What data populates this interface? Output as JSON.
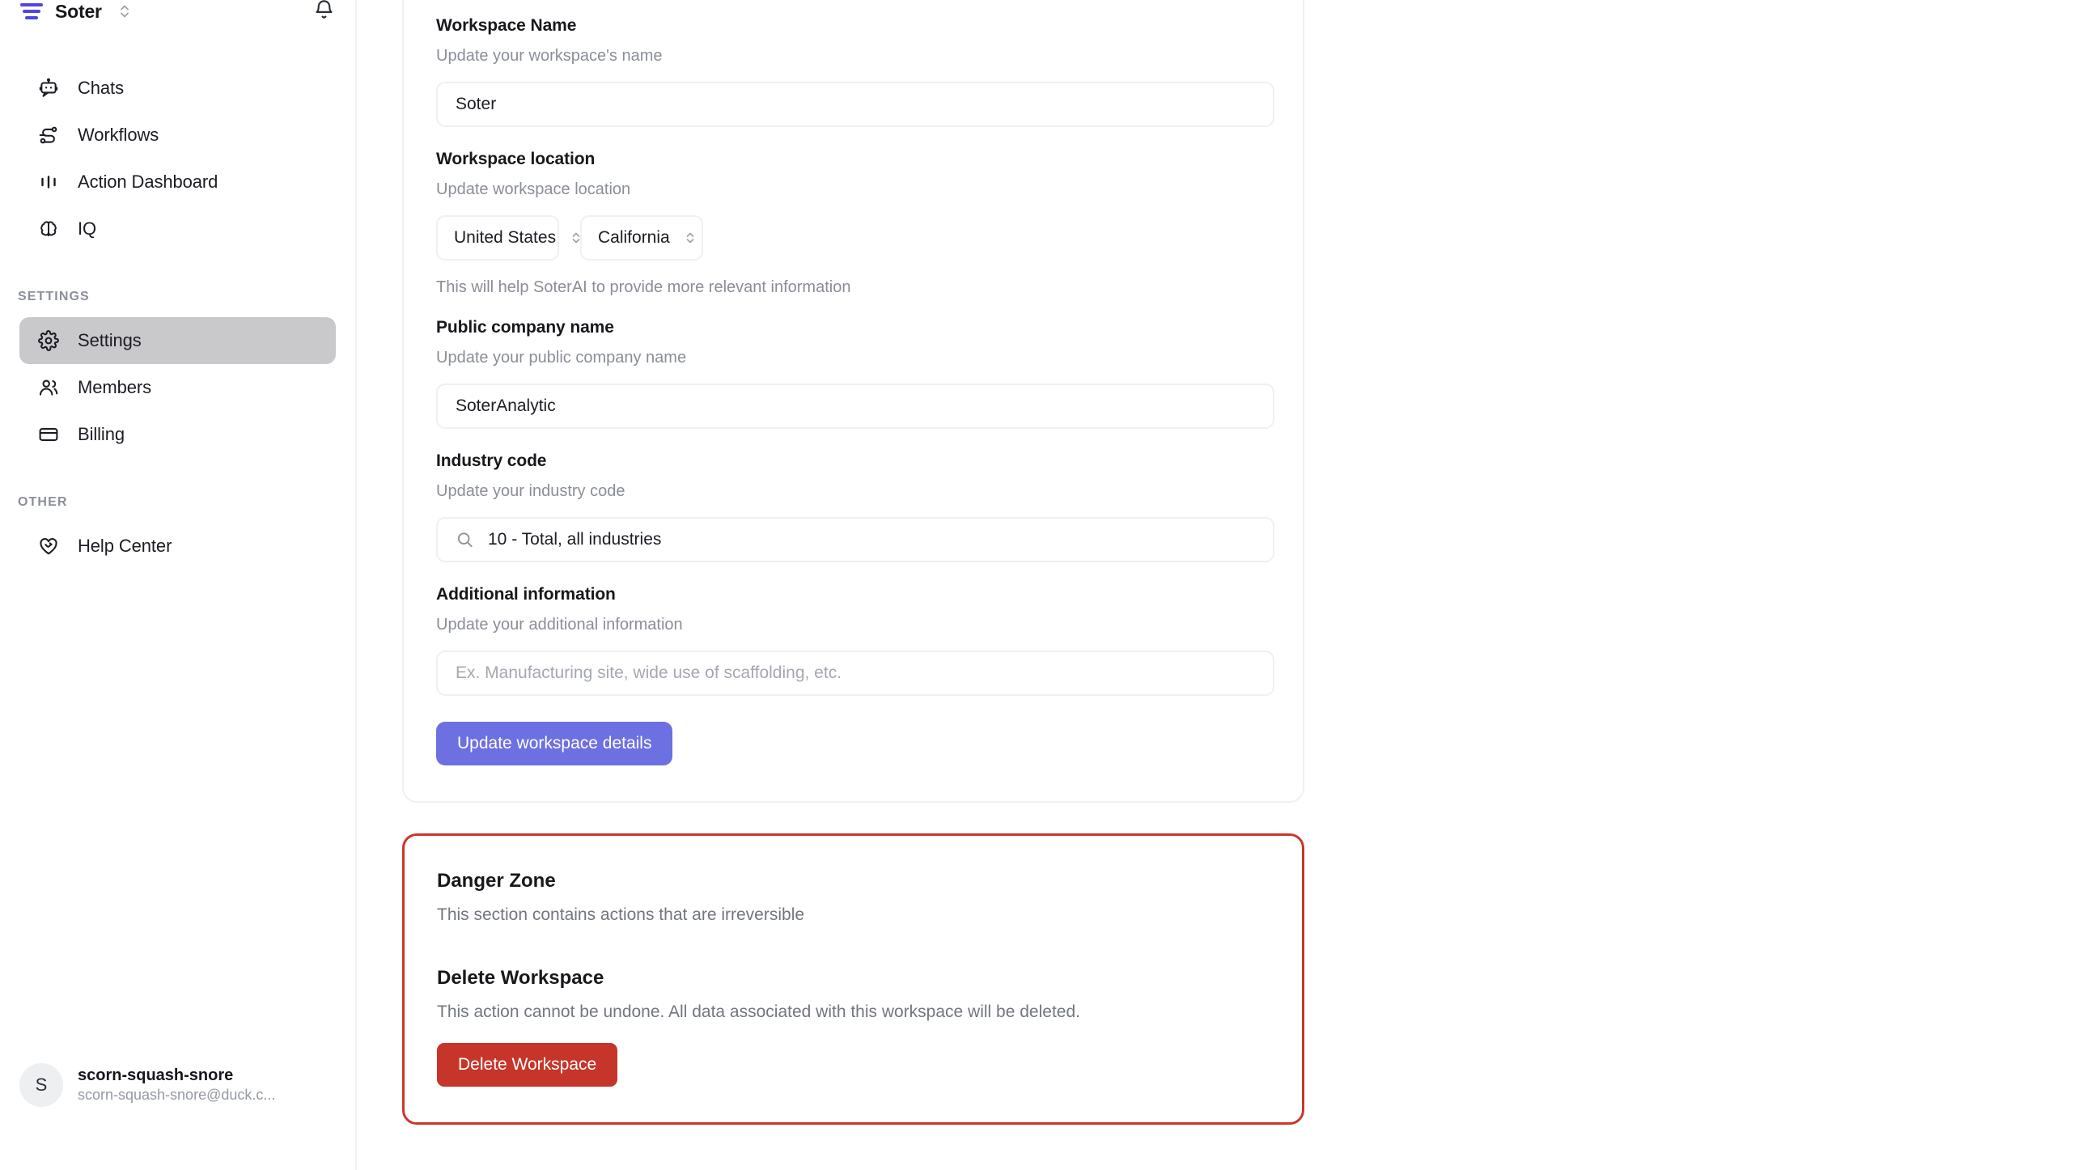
{
  "sidebar": {
    "brand": {
      "name": "Soter",
      "logo_icon": "soter-bars-logo",
      "switcher_icon": "chevron-updown-icon",
      "logo_color": "#4f46e5"
    },
    "notifications_icon": "bell-icon",
    "nav": [
      {
        "label": "Chats",
        "icon": "bot-chat-icon",
        "active": false
      },
      {
        "label": "Workflows",
        "icon": "workflow-nodes-icon",
        "active": false
      },
      {
        "label": "Action Dashboard",
        "icon": "bar-chart-icon",
        "active": false
      },
      {
        "label": "IQ",
        "icon": "brain-icon",
        "active": false
      }
    ],
    "sections": [
      {
        "title": "SETTINGS",
        "items": [
          {
            "label": "Settings",
            "icon": "gear-icon",
            "active": true
          },
          {
            "label": "Members",
            "icon": "users-icon",
            "active": false
          },
          {
            "label": "Billing",
            "icon": "credit-card-icon",
            "active": false
          }
        ]
      },
      {
        "title": "OTHER",
        "items": [
          {
            "label": "Help Center",
            "icon": "heart-handshake-icon",
            "active": false
          }
        ]
      }
    ],
    "profile": {
      "initial": "S",
      "name": "scorn-squash-snore",
      "email": "scorn-squash-snore@duck.c..."
    }
  },
  "workspace_form": {
    "workspace_name": {
      "label": "Workspace Name",
      "description": "Update your workspace's name",
      "value": "Soter",
      "placeholder": ""
    },
    "workspace_location": {
      "label": "Workspace location",
      "description": "Update workspace location",
      "country_value": "United States",
      "state_value": "California",
      "hint": "This will help SoterAI to provide more relevant information"
    },
    "public_company_name": {
      "label": "Public company name",
      "description": "Update your public company name",
      "value": "SoterAnalytic",
      "placeholder": ""
    },
    "industry_code": {
      "label": "Industry code",
      "description": "Update your industry code",
      "value": "10 - Total, all industries",
      "placeholder": "",
      "icon": "search-icon"
    },
    "additional_information": {
      "label": "Additional information",
      "description": "Update your additional information",
      "value": "",
      "placeholder": "Ex. Manufacturing site, wide use of scaffolding, etc."
    },
    "submit_label": "Update workspace details",
    "submit_color": "#6c70e0"
  },
  "danger_zone": {
    "title": "Danger Zone",
    "description": "This section contains actions that are irreversible",
    "delete_title": "Delete Workspace",
    "delete_description": "This action cannot be undone. All data associated with this workspace will be deleted.",
    "delete_button_label": "Delete Workspace",
    "border_color": "#c9372c",
    "button_color": "#c6352a"
  }
}
